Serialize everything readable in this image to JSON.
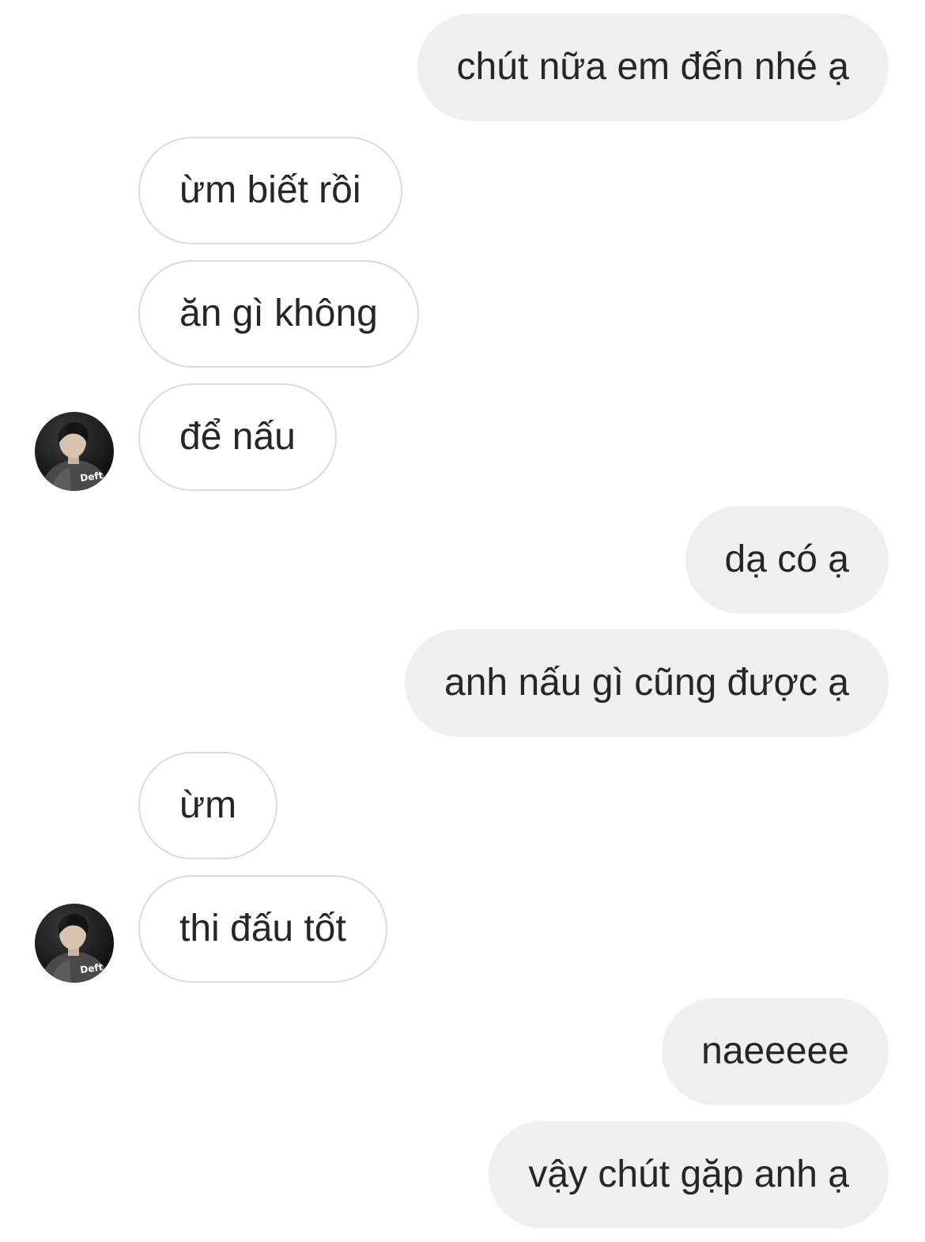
{
  "thread": {
    "messages": [
      {
        "id": 0,
        "direction": "outgoing",
        "text": "chút nữa em đến nhé ạ"
      },
      {
        "id": 1,
        "direction": "incoming",
        "text": "ừm biết rồi"
      },
      {
        "id": 2,
        "direction": "incoming",
        "text": "ăn gì không"
      },
      {
        "id": 3,
        "direction": "incoming",
        "text": "để nấu",
        "show_avatar": true
      },
      {
        "id": 4,
        "direction": "outgoing",
        "text": "dạ có ạ"
      },
      {
        "id": 5,
        "direction": "outgoing",
        "text": "anh nấu gì cũng được ạ"
      },
      {
        "id": 6,
        "direction": "incoming",
        "text": "ừm"
      },
      {
        "id": 7,
        "direction": "incoming",
        "text": "thi đấu tốt",
        "show_avatar": true
      },
      {
        "id": 8,
        "direction": "outgoing",
        "text": "naeeeee"
      },
      {
        "id": 9,
        "direction": "outgoing",
        "text": "vậy chút gặp anh ạ"
      }
    ]
  },
  "contact": {
    "avatar_icon": "contact-avatar-photo",
    "jacket_text": "Deft"
  },
  "colors": {
    "outgoing_bubble": "#efefef",
    "incoming_bubble_border": "#dbdbdb",
    "text": "#262626",
    "background": "#ffffff"
  }
}
